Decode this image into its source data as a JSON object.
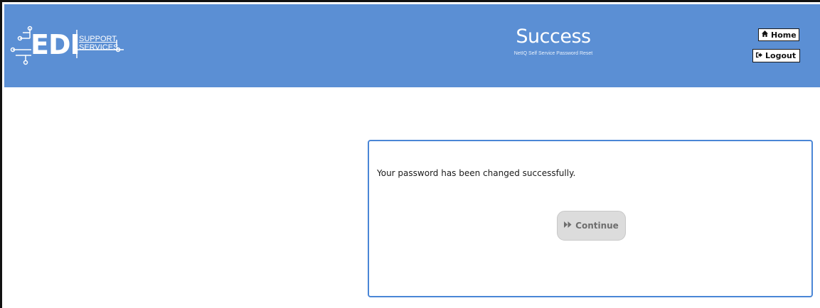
{
  "header": {
    "logo": {
      "main_text": "EDI",
      "sub_line1": "SUPPORT",
      "sub_line2": "SERVICES"
    },
    "title": "Success",
    "subtitle": "NetIQ Self Service Password Reset",
    "home_label": "Home",
    "logout_label": "Logout",
    "home_icon": "home-icon",
    "logout_icon": "logout-icon"
  },
  "main": {
    "message": "Your password has been changed successfully.",
    "continue_label": "Continue",
    "continue_icon": "fast-forward-icon"
  },
  "colors": {
    "header_bg": "#5b8fd4",
    "panel_border": "#4a86d6",
    "button_disabled_bg": "#dcdcdc"
  }
}
